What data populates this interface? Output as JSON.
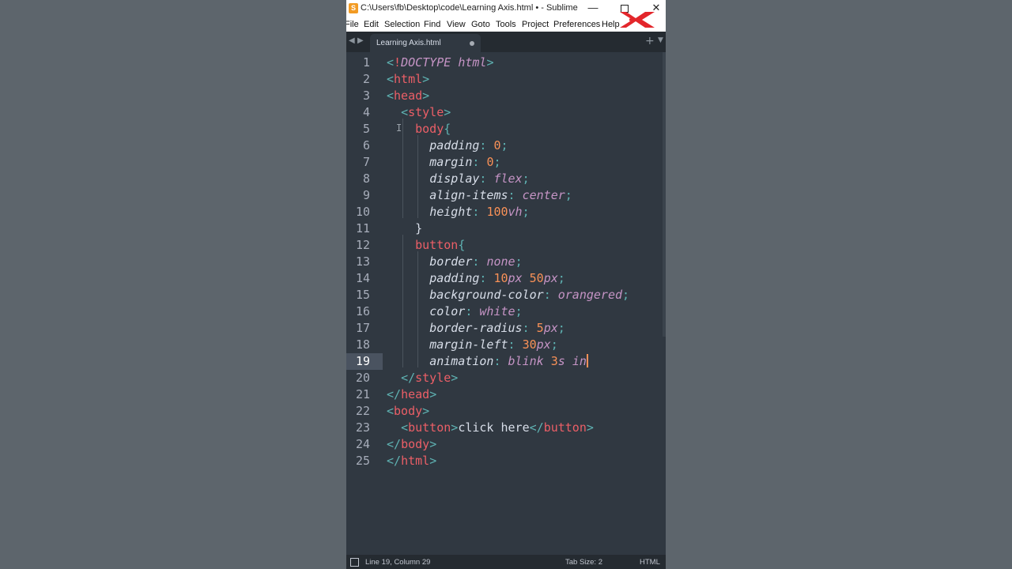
{
  "window": {
    "title": "C:\\Users\\fb\\Desktop\\code\\Learning Axis.html • - Sublime Te...",
    "controls": {
      "minimize": "—",
      "close": "✕"
    }
  },
  "menu": [
    "File",
    "Edit",
    "Selection",
    "Find",
    "View",
    "Goto",
    "Tools",
    "Project",
    "Preferences",
    "Help"
  ],
  "tab": {
    "label": "Learning Axis.html",
    "modified": true
  },
  "tabbar": {
    "new_tab": "+",
    "dropdown": "▼",
    "nav_left": "◀",
    "nav_right": "▶"
  },
  "editor": {
    "current_line": 19,
    "lines": [
      {
        "n": "1",
        "tokens": [
          [
            "punc",
            "<"
          ],
          [
            "tag",
            "!"
          ],
          [
            "ital",
            "DOCTYPE"
          ],
          [
            "text",
            " "
          ],
          [
            "ital",
            "html"
          ],
          [
            "punc",
            ">"
          ]
        ]
      },
      {
        "n": "2",
        "tokens": [
          [
            "punc",
            "<"
          ],
          [
            "tag",
            "html"
          ],
          [
            "punc",
            ">"
          ]
        ]
      },
      {
        "n": "3",
        "tokens": [
          [
            "punc",
            "<"
          ],
          [
            "tag",
            "head"
          ],
          [
            "punc",
            ">"
          ]
        ]
      },
      {
        "n": "4",
        "tokens": [
          [
            "text",
            "  "
          ],
          [
            "punc",
            "<"
          ],
          [
            "tag",
            "style"
          ],
          [
            "punc",
            ">"
          ]
        ]
      },
      {
        "n": "5",
        "tokens": [
          [
            "text",
            "    "
          ],
          [
            "tag",
            "body"
          ],
          [
            "punc",
            "{"
          ]
        ]
      },
      {
        "n": "6",
        "tokens": [
          [
            "text",
            "      "
          ],
          [
            "prop",
            "padding"
          ],
          [
            "punc",
            ": "
          ],
          [
            "num",
            "0"
          ],
          [
            "punc",
            ";"
          ]
        ]
      },
      {
        "n": "7",
        "tokens": [
          [
            "text",
            "      "
          ],
          [
            "prop",
            "margin"
          ],
          [
            "punc",
            ": "
          ],
          [
            "num",
            "0"
          ],
          [
            "punc",
            ";"
          ]
        ]
      },
      {
        "n": "8",
        "tokens": [
          [
            "text",
            "      "
          ],
          [
            "prop",
            "display"
          ],
          [
            "punc",
            ": "
          ],
          [
            "ital",
            "flex"
          ],
          [
            "punc",
            ";"
          ]
        ]
      },
      {
        "n": "9",
        "tokens": [
          [
            "text",
            "      "
          ],
          [
            "prop",
            "align-items"
          ],
          [
            "punc",
            ": "
          ],
          [
            "ital",
            "center"
          ],
          [
            "punc",
            ";"
          ]
        ]
      },
      {
        "n": "10",
        "tokens": [
          [
            "text",
            "      "
          ],
          [
            "prop",
            "height"
          ],
          [
            "punc",
            ": "
          ],
          [
            "num",
            "100"
          ],
          [
            "unit",
            "vh"
          ],
          [
            "punc",
            ";"
          ]
        ]
      },
      {
        "n": "11",
        "tokens": [
          [
            "text",
            "    "
          ],
          [
            "text",
            "}"
          ]
        ]
      },
      {
        "n": "12",
        "tokens": [
          [
            "text",
            "    "
          ],
          [
            "tag",
            "button"
          ],
          [
            "punc",
            "{"
          ]
        ]
      },
      {
        "n": "13",
        "tokens": [
          [
            "text",
            "      "
          ],
          [
            "prop",
            "border"
          ],
          [
            "punc",
            ": "
          ],
          [
            "ital",
            "none"
          ],
          [
            "punc",
            ";"
          ]
        ]
      },
      {
        "n": "14",
        "tokens": [
          [
            "text",
            "      "
          ],
          [
            "prop",
            "padding"
          ],
          [
            "punc",
            ": "
          ],
          [
            "num",
            "10"
          ],
          [
            "unit",
            "px"
          ],
          [
            "text",
            " "
          ],
          [
            "num",
            "50"
          ],
          [
            "unit",
            "px"
          ],
          [
            "punc",
            ";"
          ]
        ]
      },
      {
        "n": "15",
        "tokens": [
          [
            "text",
            "      "
          ],
          [
            "prop",
            "background-color"
          ],
          [
            "punc",
            ": "
          ],
          [
            "ital",
            "orangered"
          ],
          [
            "punc",
            ";"
          ]
        ]
      },
      {
        "n": "16",
        "tokens": [
          [
            "text",
            "      "
          ],
          [
            "prop",
            "color"
          ],
          [
            "punc",
            ": "
          ],
          [
            "ital",
            "white"
          ],
          [
            "punc",
            ";"
          ]
        ]
      },
      {
        "n": "17",
        "tokens": [
          [
            "text",
            "      "
          ],
          [
            "prop",
            "border-radius"
          ],
          [
            "punc",
            ": "
          ],
          [
            "num",
            "5"
          ],
          [
            "unit",
            "px"
          ],
          [
            "punc",
            ";"
          ]
        ]
      },
      {
        "n": "18",
        "tokens": [
          [
            "text",
            "      "
          ],
          [
            "prop",
            "margin-left"
          ],
          [
            "punc",
            ": "
          ],
          [
            "num",
            "30"
          ],
          [
            "unit",
            "px"
          ],
          [
            "punc",
            ";"
          ]
        ]
      },
      {
        "n": "19",
        "tokens": [
          [
            "text",
            "      "
          ],
          [
            "prop",
            "animation"
          ],
          [
            "punc",
            ": "
          ],
          [
            "ital",
            "blink"
          ],
          [
            "text",
            " "
          ],
          [
            "num",
            "3"
          ],
          [
            "unit",
            "s"
          ],
          [
            "text",
            " "
          ],
          [
            "ital",
            "in"
          ]
        ]
      },
      {
        "n": "20",
        "tokens": [
          [
            "text",
            "  "
          ],
          [
            "punc",
            "</"
          ],
          [
            "tag",
            "style"
          ],
          [
            "punc",
            ">"
          ]
        ]
      },
      {
        "n": "21",
        "tokens": [
          [
            "punc",
            "</"
          ],
          [
            "tag",
            "head"
          ],
          [
            "punc",
            ">"
          ]
        ]
      },
      {
        "n": "22",
        "tokens": [
          [
            "punc",
            "<"
          ],
          [
            "tag",
            "body"
          ],
          [
            "punc",
            ">"
          ]
        ]
      },
      {
        "n": "23",
        "tokens": [
          [
            "text",
            "  "
          ],
          [
            "punc",
            "<"
          ],
          [
            "tag",
            "button"
          ],
          [
            "punc",
            ">"
          ],
          [
            "text",
            "click here"
          ],
          [
            "punc",
            "</"
          ],
          [
            "tag",
            "button"
          ],
          [
            "punc",
            ">"
          ]
        ]
      },
      {
        "n": "24",
        "tokens": [
          [
            "punc",
            "</"
          ],
          [
            "tag",
            "body"
          ],
          [
            "punc",
            ">"
          ]
        ]
      },
      {
        "n": "25",
        "tokens": [
          [
            "punc",
            "</"
          ],
          [
            "tag",
            "html"
          ],
          [
            "punc",
            ">"
          ]
        ]
      }
    ]
  },
  "status": {
    "position": "Line 19, Column 29",
    "tab_size": "Tab Size: 2",
    "syntax": "HTML"
  },
  "colors": {
    "editor_bg": "#303841",
    "tag": "#ec5f67",
    "punctuation": "#5fb3b3",
    "keyword_italic": "#c594c5",
    "number": "#f99157",
    "text": "#d8dee9",
    "logo": "#e3262b"
  },
  "icons": [
    "sublime-app-icon",
    "learning-axis-logo-icon",
    "panel-toggle-icon",
    "text-cursor-icon"
  ]
}
